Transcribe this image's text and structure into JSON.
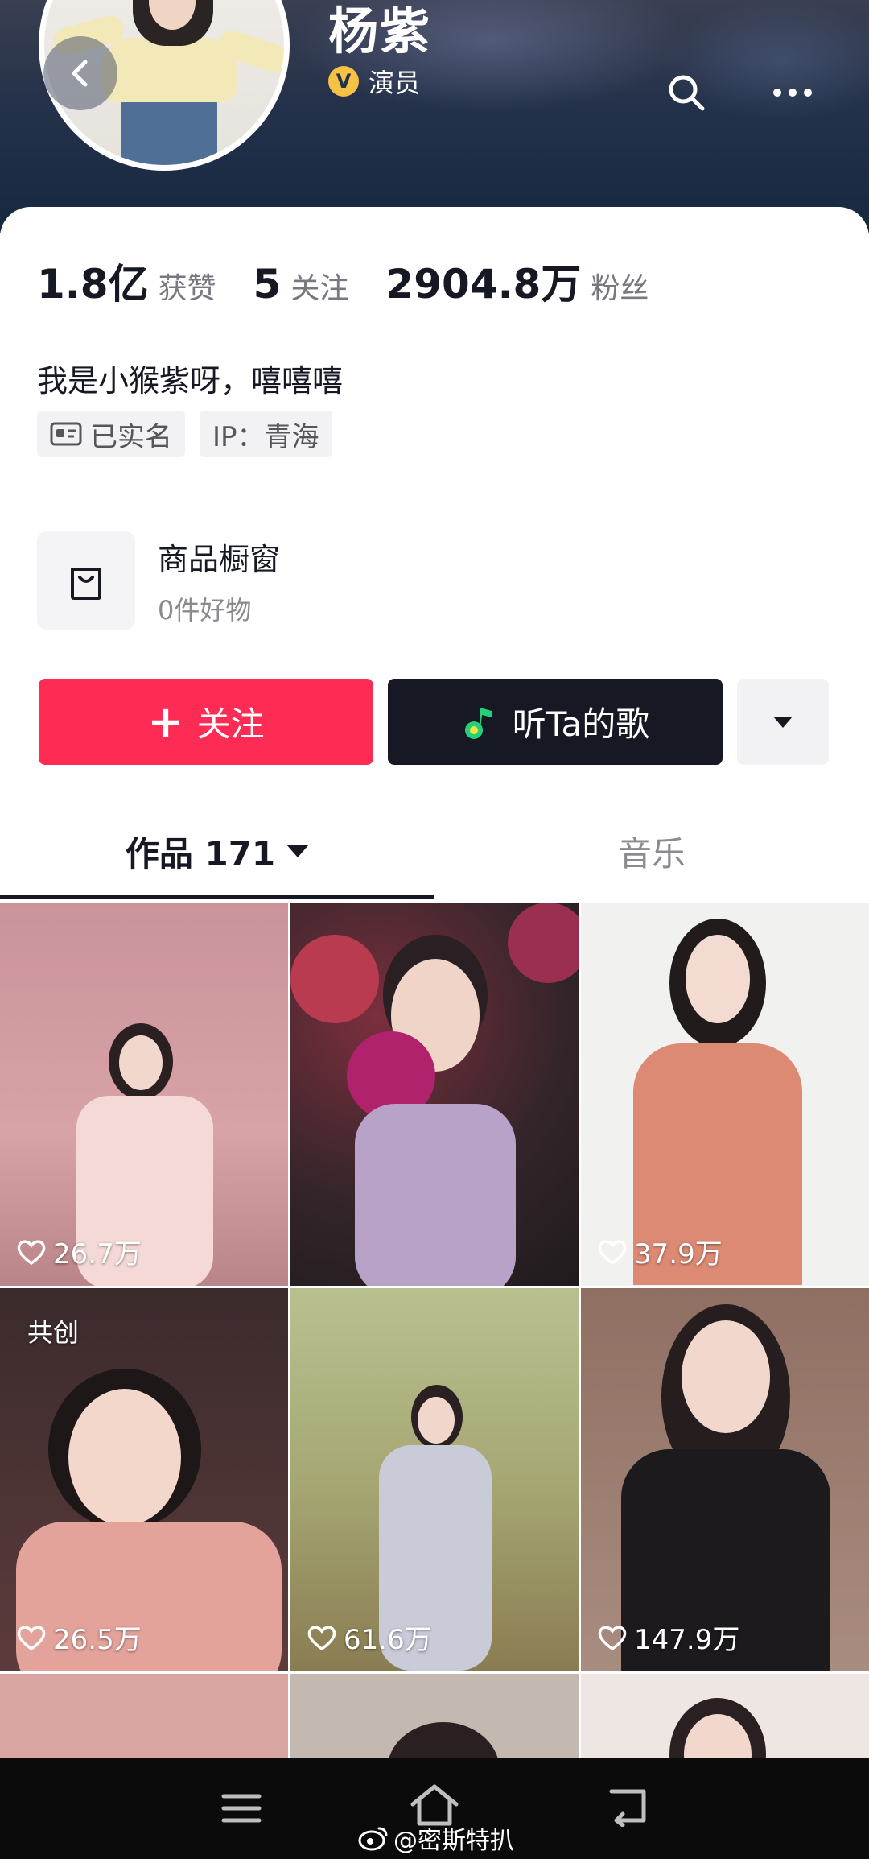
{
  "profile": {
    "name": "杨紫",
    "verified_label": "演员",
    "verified_badge": "V",
    "bio": "我是小猴紫呀，嘻嘻嘻",
    "tags": {
      "real_name": "已实名",
      "ip": "IP：青海"
    }
  },
  "stats": [
    {
      "value": "1.8亿",
      "label": "获赞"
    },
    {
      "value": "5",
      "label": "关注"
    },
    {
      "value": "2904.8万",
      "label": "粉丝"
    }
  ],
  "shop": {
    "title": "商品橱窗",
    "subtitle": "0件好物"
  },
  "actions": {
    "follow_label": "关注",
    "song_label": "听Ta的歌"
  },
  "tabs": {
    "works_label": "作品 171",
    "music_label": "音乐"
  },
  "videos": [
    {
      "likes": "26.7万"
    },
    {
      "likes": ""
    },
    {
      "likes": "37.9万"
    },
    {
      "likes": "26.5万",
      "badge": "共创"
    },
    {
      "likes": "61.6万"
    },
    {
      "likes": "147.9万"
    }
  ],
  "watermark": "@密斯特扒",
  "colors": {
    "follow": "#fe2c55",
    "dark_button": "#161823",
    "verified": "#f5c243"
  }
}
